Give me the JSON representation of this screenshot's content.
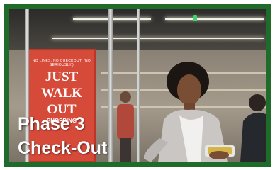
{
  "image": {
    "frame_color": "#1f6b2a",
    "sign": {
      "small_text": "NO LINES. NO CHECKOUT. (NO SERIOUSLY.)",
      "line1": "JUST",
      "line2": "WALK",
      "line3": "OUT",
      "line4": "SHOPPING",
      "color": "#d64a3a"
    },
    "caption": {
      "line1": "Phase 3",
      "line2": "Check-Out"
    }
  }
}
